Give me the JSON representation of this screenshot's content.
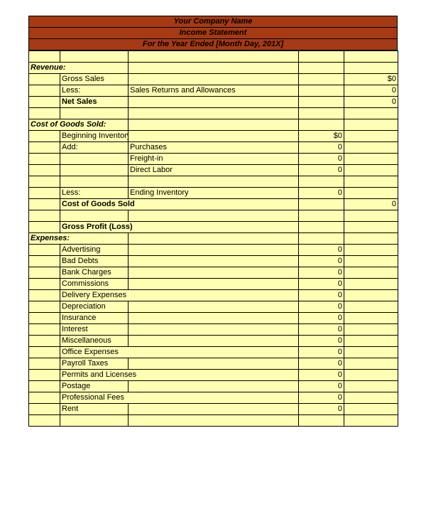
{
  "header": {
    "company": "Your Company Name",
    "title": "Income Statement",
    "period": "For the Year Ended [Month Day, 201X]"
  },
  "sections": {
    "revenue": "Revenue:",
    "cogs": "Cost of Goods Sold:",
    "expenses": "Expenses:"
  },
  "rows": {
    "gross_sales": "Gross Sales",
    "less1": "Less:",
    "sales_returns": "Sales Returns and Allowances",
    "net_sales": "Net Sales",
    "beg_inv": "Beginning Inventory",
    "add": "Add:",
    "purchases": "Purchases",
    "freight": "Freight-in",
    "direct_labor": "Direct Labor",
    "less2": "Less:",
    "end_inv": "Ending Inventory",
    "cogs_total": "Cost of Goods Sold",
    "gross_profit": "Gross Profit (Loss)",
    "advertising": "Advertising",
    "bad_debts": "Bad Debts",
    "bank_charges": "Bank Charges",
    "commissions": "Commissions",
    "delivery": "Delivery Expenses",
    "depreciation": "Depreciation",
    "insurance": "Insurance",
    "interest": "Interest",
    "misc": "Miscellaneous",
    "office": "Office Expenses",
    "payroll": "Payroll Taxes",
    "permits": "Permits and Licenses",
    "postage": "Postage",
    "prof_fees": "Professional Fees",
    "rent": "Rent"
  },
  "values": {
    "gross_sales_amt": "$0",
    "sales_returns_amt": "0",
    "net_sales_amt": "0",
    "beg_inv_amt": "$0",
    "purchases_amt": "0",
    "freight_amt": "0",
    "direct_labor_amt": "0",
    "end_inv_amt": "0",
    "cogs_total_amt": "0",
    "advertising_amt": "0",
    "bad_debts_amt": "0",
    "bank_charges_amt": "0",
    "commissions_amt": "0",
    "delivery_amt": "0",
    "depreciation_amt": "0",
    "insurance_amt": "0",
    "interest_amt": "0",
    "misc_amt": "0",
    "office_amt": "0",
    "payroll_amt": "0",
    "permits_amt": "0",
    "postage_amt": "0",
    "prof_fees_amt": "0",
    "rent_amt": "0"
  }
}
